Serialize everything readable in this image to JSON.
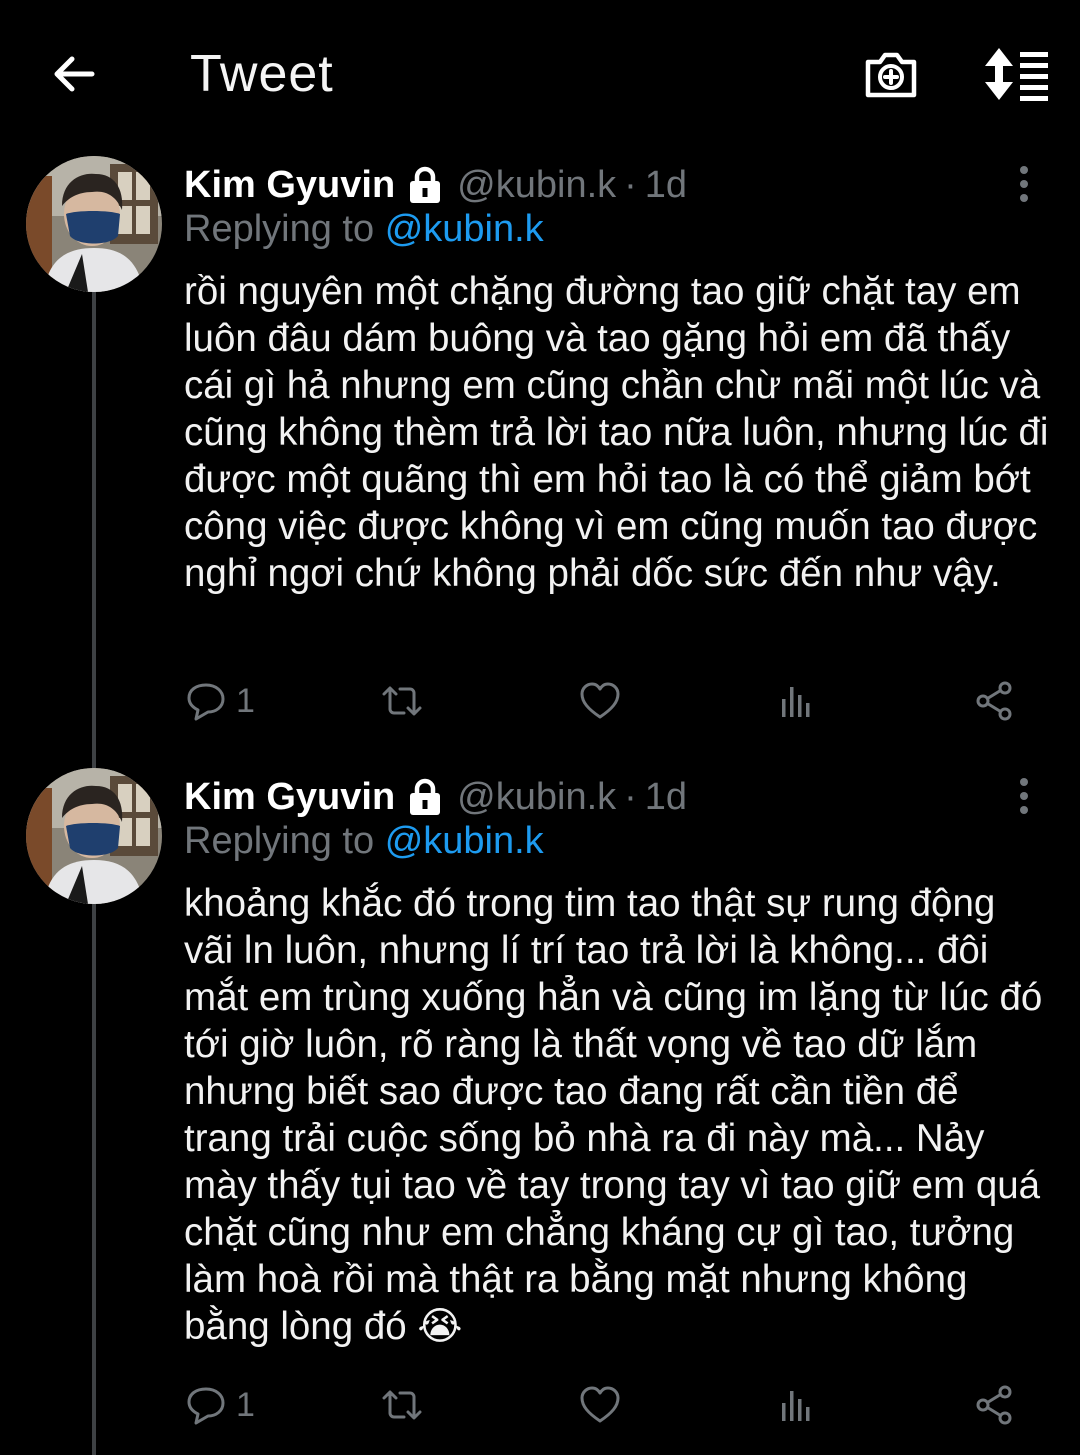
{
  "header": {
    "title": "Tweet"
  },
  "colors": {
    "background": "#000000",
    "text": "#e7e9ea",
    "muted": "#71767b",
    "accent": "#1d9bf0",
    "thread_line": "#3e4144"
  },
  "icons": {
    "back": "arrow-left-icon",
    "camera": "camera-plus-icon",
    "sort": "sort-list-icon",
    "lock": "lock-icon",
    "more": "more-vertical-icon",
    "reply": "reply-icon",
    "retweet": "retweet-icon",
    "like": "heart-icon",
    "stats": "bar-chart-icon",
    "share": "share-icon"
  },
  "tweets": [
    {
      "name": "Kim Gyuvin",
      "handle": "@kubin.k",
      "separator": "·",
      "time": "1d",
      "replying_prefix": "Replying to",
      "replying_to": "@kubin.k",
      "text": "rồi nguyên một chặng đường tao giữ chặt tay em luôn đâu dám buông và tao gặng hỏi em đã thấy cái gì hả nhưng em cũng chần chừ mãi một lúc và cũng không thèm trả lời tao nữa luôn, nhưng lúc đi được một quãng thì em hỏi tao là có thể giảm bớt công việc được không vì em cũng muốn tao được nghỉ ngơi chứ không phải dốc sức đến như vậy.",
      "reply_count": "1"
    },
    {
      "name": "Kim Gyuvin",
      "handle": "@kubin.k",
      "separator": "·",
      "time": "1d",
      "replying_prefix": "Replying to",
      "replying_to": "@kubin.k",
      "text": "khoảng khắc đó trong tim tao thật sự rung động vãi ln luôn, nhưng lí trí tao trả lời là không... đôi mắt em trùng xuống hẳn và cũng im lặng từ lúc đó tới giờ luôn, rõ ràng là thất vọng về tao dữ lắm nhưng biết sao được tao đang rất cần tiền để trang trải cuộc sống bỏ nhà ra đi này mà... Nảy mày thấy tụi tao về tay trong tay vì tao giữ em quá chặt cũng như em chẳng kháng cự gì tao, tưởng làm hoà rồi mà thật ra bằng mặt nhưng không bằng lòng đó 😭",
      "reply_count": "1"
    }
  ]
}
